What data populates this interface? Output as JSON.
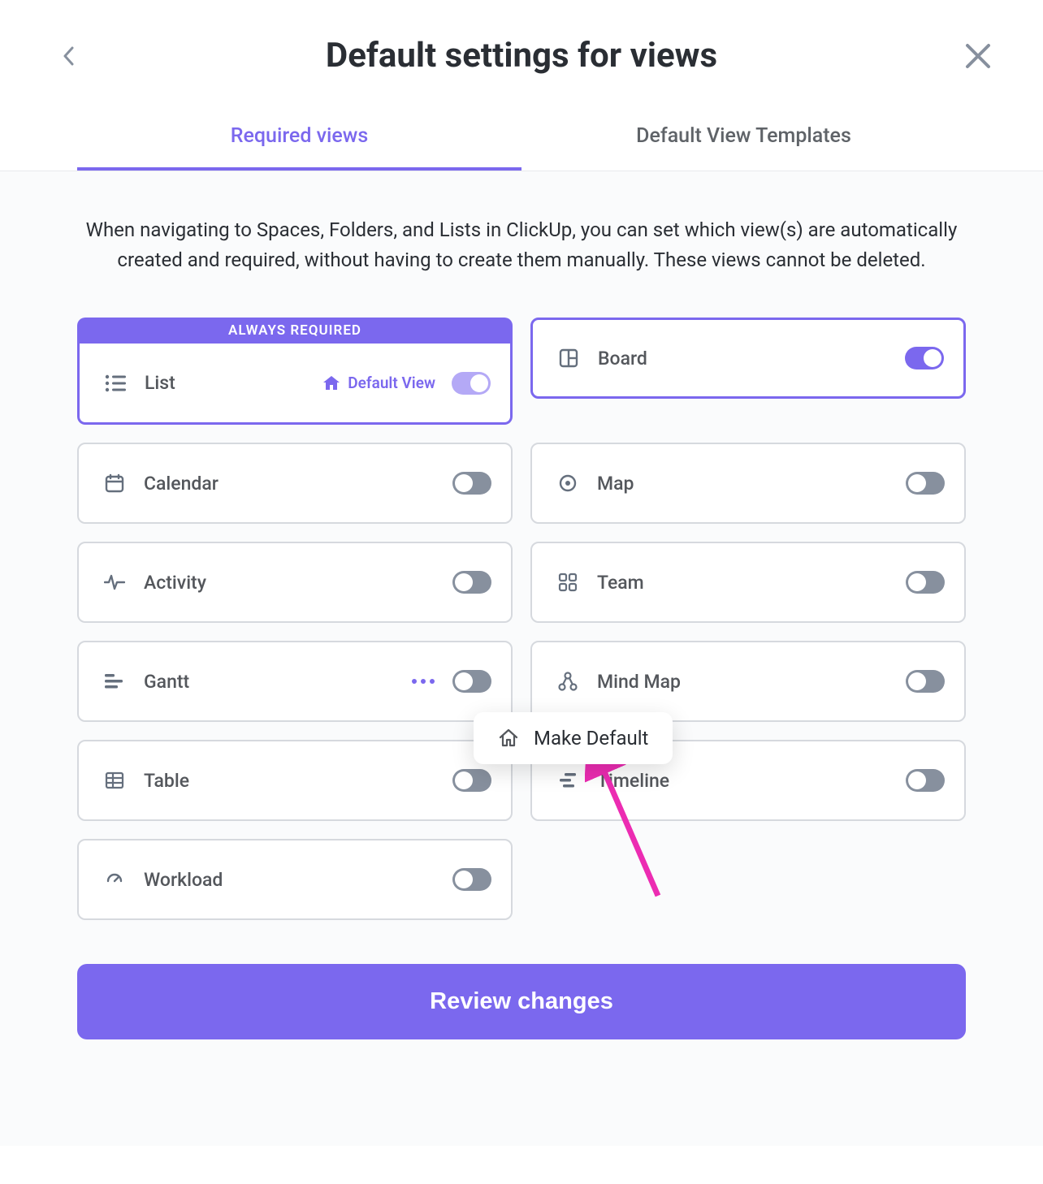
{
  "header": {
    "title": "Default settings for views"
  },
  "tabs": {
    "required": "Required views",
    "templates": "Default View Templates"
  },
  "description": "When navigating to Spaces, Folders, and Lists in ClickUp, you can set which view(s) are automatically created and required, without having to create them manually. These views cannot be deleted.",
  "always_required_label": "ALWAYS REQUIRED",
  "default_view_label": "Default View",
  "views": {
    "list": "List",
    "board": "Board",
    "calendar": "Calendar",
    "map": "Map",
    "activity": "Activity",
    "team": "Team",
    "gantt": "Gantt",
    "mindmap": "Mind Map",
    "table": "Table",
    "timeline": "Timeline",
    "workload": "Workload"
  },
  "popover": {
    "make_default": "Make Default"
  },
  "buttons": {
    "review": "Review changes"
  }
}
